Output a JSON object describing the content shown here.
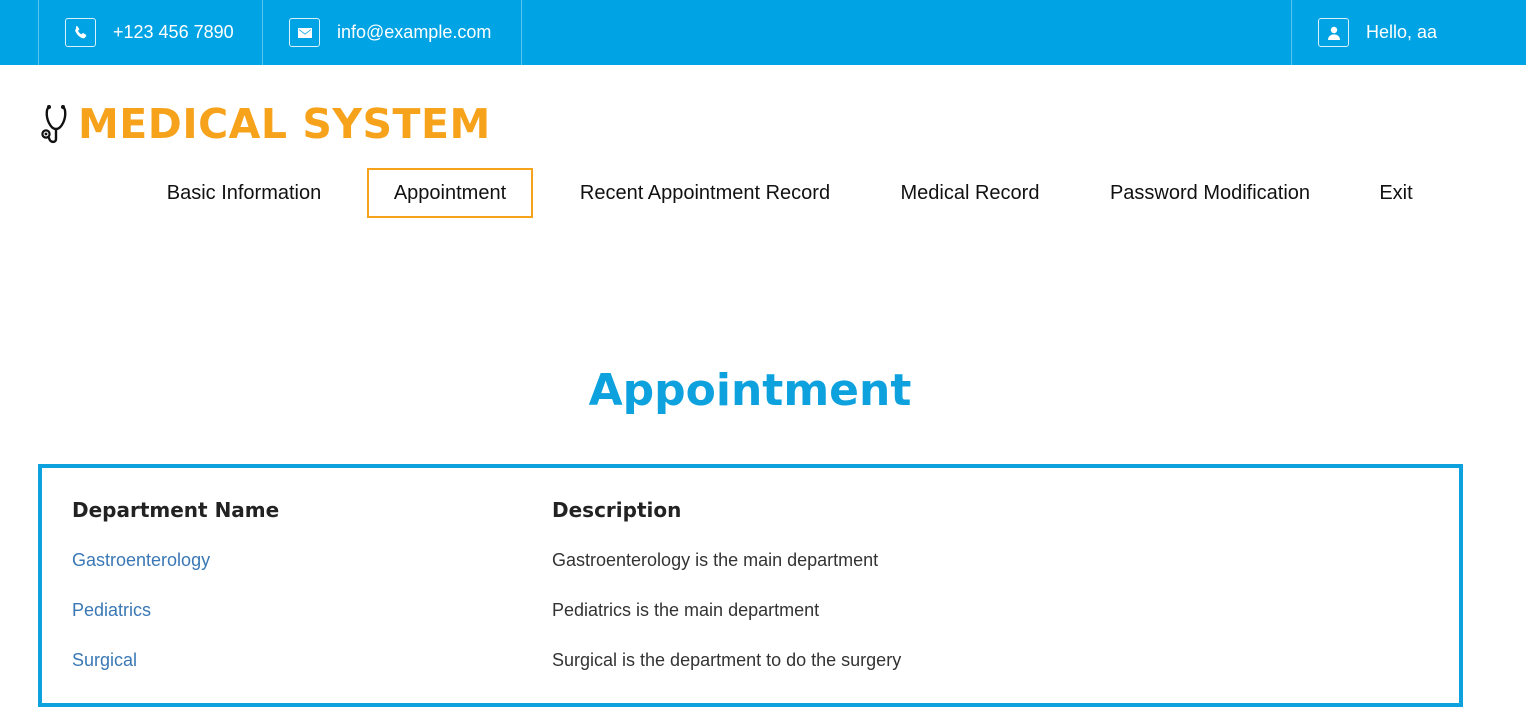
{
  "topbar": {
    "phone": "+123 456 7890",
    "email": "info@example.com",
    "greeting": "Hello, aa",
    "background": "#00a3e3"
  },
  "logo": {
    "text": "MEDICAL SYSTEM",
    "icon": "stethoscope-icon",
    "color": "#f7a21b"
  },
  "nav": {
    "items": [
      {
        "label": "Basic Information"
      },
      {
        "label": "Appointment",
        "active": true
      },
      {
        "label": "Recent Appointment Record"
      },
      {
        "label": "Medical Record"
      },
      {
        "label": "Password Modification"
      },
      {
        "label": "Exit"
      }
    ]
  },
  "page": {
    "title": "Appointment",
    "accent": "#0da2de"
  },
  "table": {
    "headers": [
      "Department Name",
      "Description"
    ],
    "rows": [
      {
        "name": "Gastroenterology",
        "description": "Gastroenterology is the main department"
      },
      {
        "name": "Pediatrics",
        "description": "Pediatrics is the main department"
      },
      {
        "name": "Surgical",
        "description": "Surgical is the department to do the surgery"
      }
    ]
  }
}
